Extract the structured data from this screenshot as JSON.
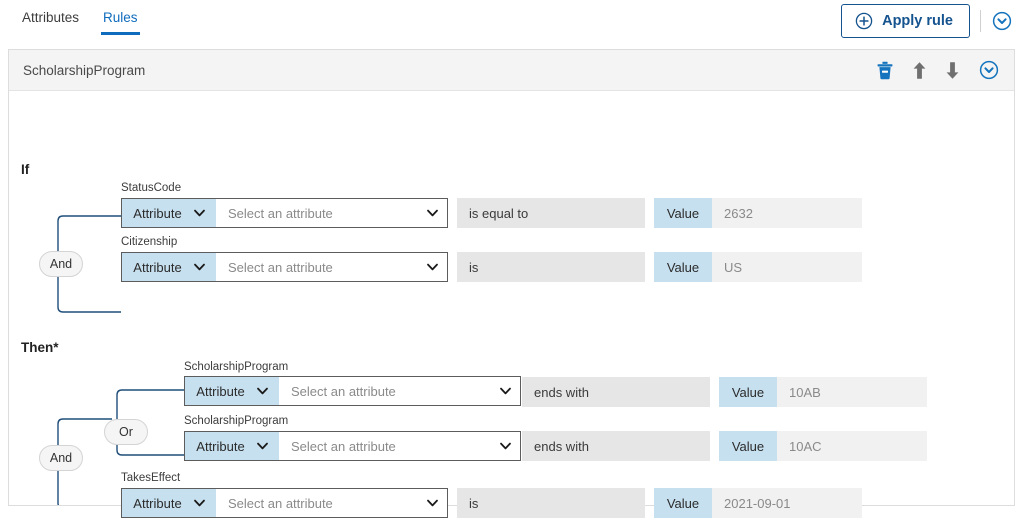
{
  "tabs": [
    {
      "label": "Attributes",
      "active": false,
      "name": "tab-attributes"
    },
    {
      "label": "Rules",
      "active": true,
      "name": "tab-rules"
    }
  ],
  "toolbar": {
    "apply_label": "Apply rule",
    "apply_icon": "plus-circle-icon",
    "expand_icon": "chevron-down-circle-icon"
  },
  "card": {
    "title": "ScholarshipProgram",
    "actions": [
      {
        "name": "delete-icon",
        "glyph": "trash"
      },
      {
        "name": "move-up-icon",
        "glyph": "arrow-up"
      },
      {
        "name": "move-down-icon",
        "glyph": "arrow-down"
      },
      {
        "name": "collapse-icon",
        "glyph": "chevron-down-circle"
      }
    ]
  },
  "if_section": {
    "heading": "If",
    "connector": "And",
    "rows": [
      {
        "field_label": "StatusCode",
        "attribute_type": "Attribute",
        "attribute_placeholder": "Select an attribute",
        "operator": "is equal to",
        "value_label": "Value",
        "value": "2632"
      },
      {
        "field_label": "Citizenship",
        "attribute_type": "Attribute",
        "attribute_placeholder": "Select an attribute",
        "operator": "is",
        "value_label": "Value",
        "value": "US"
      }
    ]
  },
  "then_section": {
    "heading": "Then*",
    "outer_connector": "And",
    "inner_connector": "Or",
    "group_rows": [
      {
        "field_label": "ScholarshipProgram",
        "attribute_type": "Attribute",
        "attribute_placeholder": "Select an attribute",
        "operator": "ends with",
        "value_label": "Value",
        "value": "10AB"
      },
      {
        "field_label": "ScholarshipProgram",
        "attribute_type": "Attribute",
        "attribute_placeholder": "Select an attribute",
        "operator": "ends with",
        "value_label": "Value",
        "value": "10AC"
      }
    ],
    "tail_row": {
      "field_label": "TakesEffect",
      "attribute_type": "Attribute",
      "attribute_placeholder": "Select an attribute",
      "operator": "is",
      "value_label": "Value",
      "value": "2021-09-01"
    }
  },
  "colors": {
    "accent_blue": "#0f6cbd",
    "button_blue": "#15538f",
    "segment_blue": "#c7e0ef",
    "field_gray": "#e6e6e6",
    "value_gray": "#f1f1f1",
    "connector_line": "#1f4e79"
  }
}
